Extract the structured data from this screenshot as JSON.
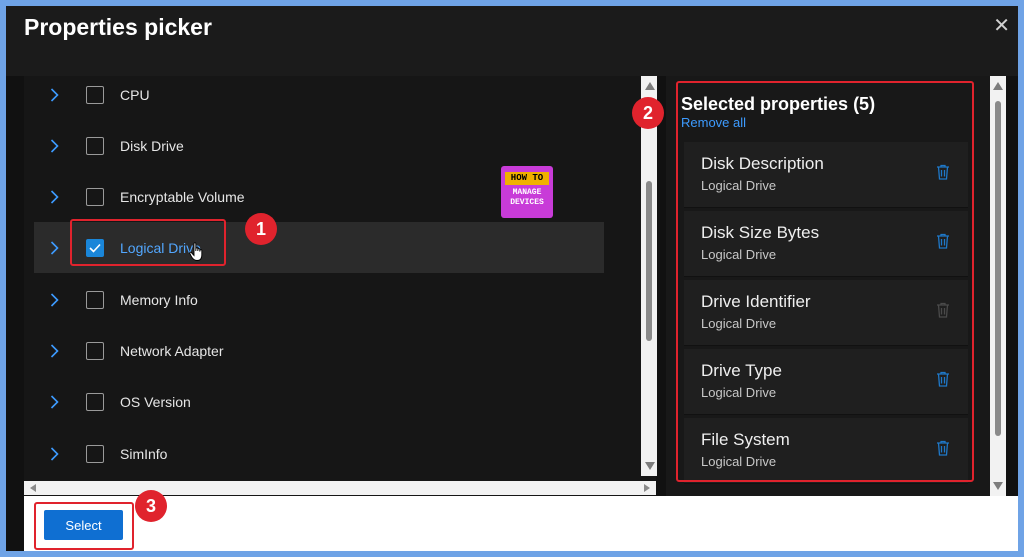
{
  "dialog": {
    "title": "Properties picker",
    "close_glyph": "✕"
  },
  "properties": [
    {
      "label": "CPU",
      "checked": false
    },
    {
      "label": "Disk Drive",
      "checked": false
    },
    {
      "label": "Encryptable Volume",
      "checked": false
    },
    {
      "label": "Logical Drive",
      "checked": true
    },
    {
      "label": "Memory Info",
      "checked": false
    },
    {
      "label": "Network Adapter",
      "checked": false
    },
    {
      "label": "OS Version",
      "checked": false
    },
    {
      "label": "SimInfo",
      "checked": false
    }
  ],
  "selected_panel": {
    "title": "Selected properties (5)",
    "remove_all": "Remove all",
    "items": [
      {
        "name": "Disk Description",
        "source": "Logical Drive",
        "trash_enabled": true
      },
      {
        "name": "Disk Size Bytes",
        "source": "Logical Drive",
        "trash_enabled": true
      },
      {
        "name": "Drive Identifier",
        "source": "Logical Drive",
        "trash_enabled": false
      },
      {
        "name": "Drive Type",
        "source": "Logical Drive",
        "trash_enabled": true
      },
      {
        "name": "File System",
        "source": "Logical Drive",
        "trash_enabled": true
      }
    ]
  },
  "footer": {
    "select_label": "Select"
  },
  "annotations": {
    "step1": "1",
    "step2": "2",
    "step3": "3"
  },
  "watermark": {
    "line1": "HOW TO",
    "line2": "MANAGE",
    "line3": "DEVICES"
  },
  "colors": {
    "accent": "#1a86d9",
    "link": "#3d9bff",
    "button": "#0f6fd2",
    "highlight": "#e0232d",
    "trash_enabled": "#1f78c8",
    "trash_disabled": "#4a4a4a"
  },
  "icons": {
    "expand": "chevron-right-icon",
    "delete": "trash-icon",
    "close": "close-icon",
    "check": "checkmark-icon",
    "pointer": "hand-cursor-icon"
  }
}
